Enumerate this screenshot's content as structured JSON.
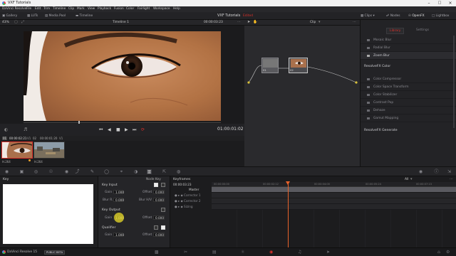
{
  "window": {
    "title": "VXF Tutorials"
  },
  "menu": [
    "DaVinci Resolve",
    "File",
    "Edit",
    "Trim",
    "Timeline",
    "Clip",
    "Mark",
    "View",
    "Playback",
    "Fusion",
    "Color",
    "Fairlight",
    "Workspace",
    "Help"
  ],
  "project": {
    "name": "VXF Tutorials",
    "status": "Edited"
  },
  "toolbar": {
    "left": [
      "Gallery",
      "LUTs",
      "Media Pool",
      "Timeline"
    ],
    "right": [
      "Clips",
      "Nodes",
      "OpenFX",
      "Lightbox"
    ]
  },
  "viewer": {
    "zoom": "43%",
    "timeline_name": "Timeline 1",
    "timecode_top": "00:00:03:23",
    "timecode": "01:00:01:02"
  },
  "clips": {
    "items": [
      {
        "num": "01",
        "timecode": "00:00:02:21",
        "track": "V1",
        "codec": "H.264"
      },
      {
        "num": "02",
        "timecode": "00:00:01:20",
        "track": "V1",
        "codec": "H.264"
      }
    ]
  },
  "nodes": {
    "mode": "Clip",
    "node_labels": [
      "01",
      "02"
    ]
  },
  "openfx": {
    "tabs": [
      "Library",
      "Settings"
    ],
    "blur_items": [
      "Mosaic Blur",
      "Radial Blur",
      "Zoom Blur"
    ],
    "color_section": "ResolveFX Color",
    "color_items": [
      "Color Compressor",
      "Color Space Transform",
      "Color Stabilizer",
      "Contrast Pop",
      "Dehaze",
      "Gamut Mapping"
    ],
    "generate_section": "ResolveFX Generate"
  },
  "key_panel": {
    "title": "Key",
    "node_key_label": "Node Key"
  },
  "key_controls": {
    "key_input": {
      "label": "Key Input",
      "gain_label": "Gain",
      "gain": "1.000",
      "offset_label": "Offset",
      "offset": "0.000",
      "blurr_label": "Blur R.",
      "blurr": "0.000",
      "blurhv_label": "Blur H/V",
      "blurhv": "0.000"
    },
    "key_output": {
      "label": "Key Output",
      "gain_label": "Gain",
      "gain": "1.000",
      "offset_label": "Offset",
      "offset": "0.000"
    },
    "qualifier": {
      "label": "Qualifier",
      "gain_label": "Gain",
      "gain": "1.000",
      "offset_label": "Offset",
      "offset": "0.000"
    }
  },
  "keyframes": {
    "title": "Keyframes",
    "filter": "All",
    "timecode": "00:00:03:23",
    "ruler": [
      "00:00:00:00",
      "00:00:02:12",
      "00:00:04:00",
      "00:00:05:24",
      "00:00:07:13"
    ],
    "rows": [
      "Master",
      "Corrector 1",
      "Corrector 2",
      "Sizing"
    ]
  },
  "status": {
    "app": "DaVinci Resolve 15",
    "badge": "PUBLIC BETA"
  },
  "colors": {
    "accent": "#d9302a",
    "playhead": "#e8622a"
  }
}
